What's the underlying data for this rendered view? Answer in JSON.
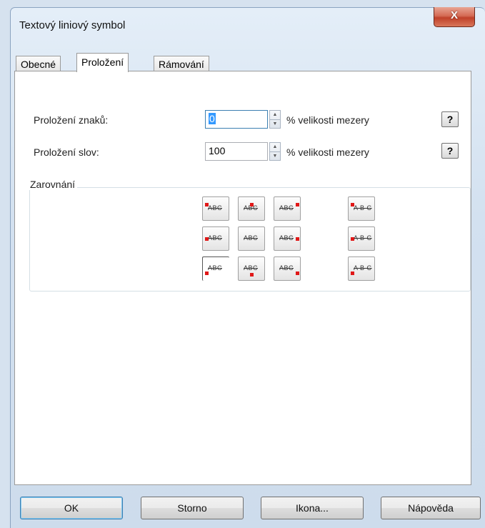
{
  "window": {
    "title": "Textový liniový symbol",
    "close_label": "X"
  },
  "tabs": [
    {
      "label": "Obecné"
    },
    {
      "label": "Proložení"
    },
    {
      "label": "Rámování"
    }
  ],
  "spacing": {
    "chars_label": "Proložení znaků:",
    "chars_value": "0",
    "chars_unit": "% velikosti mezery",
    "words_label": "Proložení slov:",
    "words_value": "100",
    "words_unit": "% velikosti mezery",
    "help_label": "?"
  },
  "alignment": {
    "group_title": "Zarovnání",
    "sample_text": "ABC",
    "sample_text_spaced": "A B C",
    "selected": "bottom-left"
  },
  "buttons": {
    "ok": "OK",
    "cancel": "Storno",
    "icon": "Ikona...",
    "help": "Nápověda"
  }
}
